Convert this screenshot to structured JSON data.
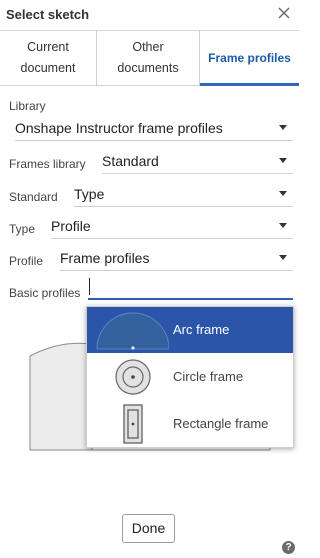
{
  "dialog": {
    "title": "Select sketch",
    "close_icon": "close-icon"
  },
  "tabs": [
    {
      "label": "Current\ndocument",
      "active": false
    },
    {
      "label": "Other\ndocuments",
      "active": false
    },
    {
      "label": "Frame profiles",
      "active": true
    }
  ],
  "form": {
    "library_label": "Library",
    "library_value": "Onshape Instructor frame profiles",
    "frames_library_label": "Frames library",
    "frames_library_value": "Standard",
    "standard_label": "Standard",
    "standard_value": "Type",
    "type_label": "Type",
    "type_value": "Profile",
    "profile_label": "Profile",
    "profile_value": "Frame profiles",
    "basic_profiles_label": "Basic profiles",
    "basic_profiles_value": ""
  },
  "dropdown": {
    "options": [
      {
        "label": "Arc frame",
        "icon": "arc-frame-icon",
        "selected": true
      },
      {
        "label": "Circle frame",
        "icon": "circle-frame-icon",
        "selected": false
      },
      {
        "label": "Rectangle frame",
        "icon": "rectangle-frame-icon",
        "selected": false
      }
    ]
  },
  "footer": {
    "done_label": "Done",
    "help_label": "?"
  },
  "colors": {
    "accent": "#2a55a8",
    "active_tab_text": "#1a5dab"
  }
}
